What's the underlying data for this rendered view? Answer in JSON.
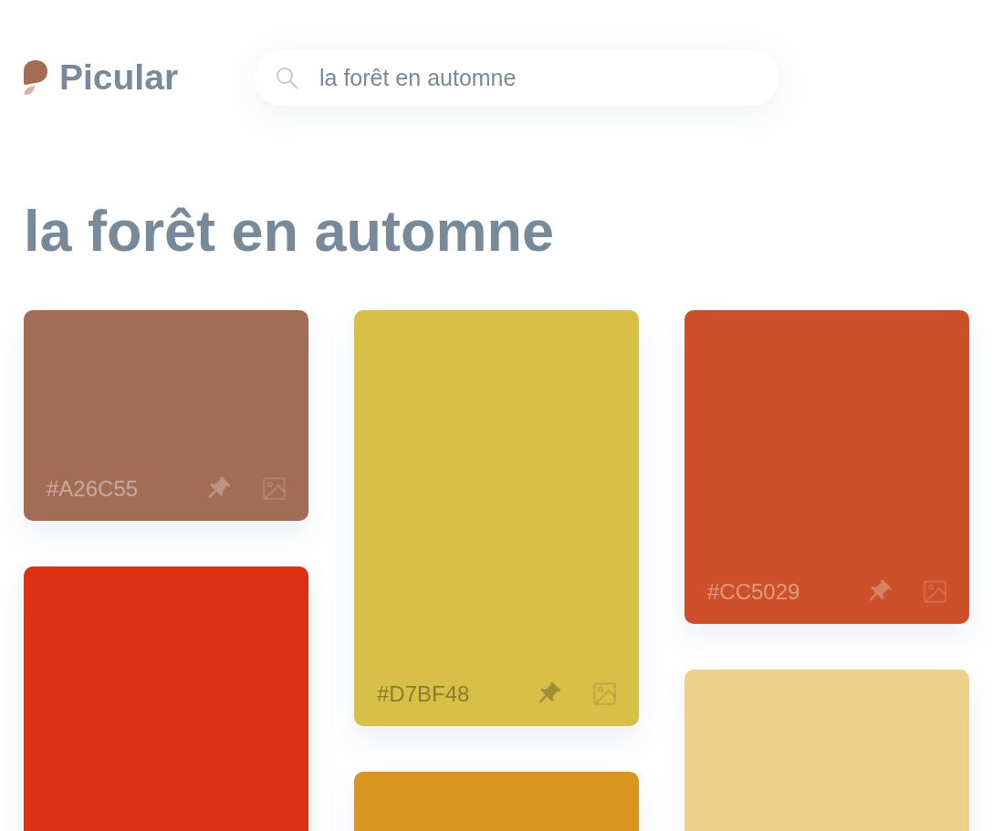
{
  "brand": {
    "name": "Picular"
  },
  "search": {
    "value": "la forêt en automne"
  },
  "heading": "la forêt en automne",
  "columns": [
    {
      "cards": [
        {
          "color": "#a26c55",
          "hex": "#A26C55"
        },
        {
          "color": "#de3013"
        }
      ]
    },
    {
      "cards": [
        {
          "color": "#d7bf48",
          "hex": "#D7BF48"
        },
        {
          "color": "#d99520"
        }
      ]
    },
    {
      "cards": [
        {
          "color": "#cc5029",
          "hex": "#CC5029"
        },
        {
          "color": "#edd089"
        }
      ]
    }
  ]
}
